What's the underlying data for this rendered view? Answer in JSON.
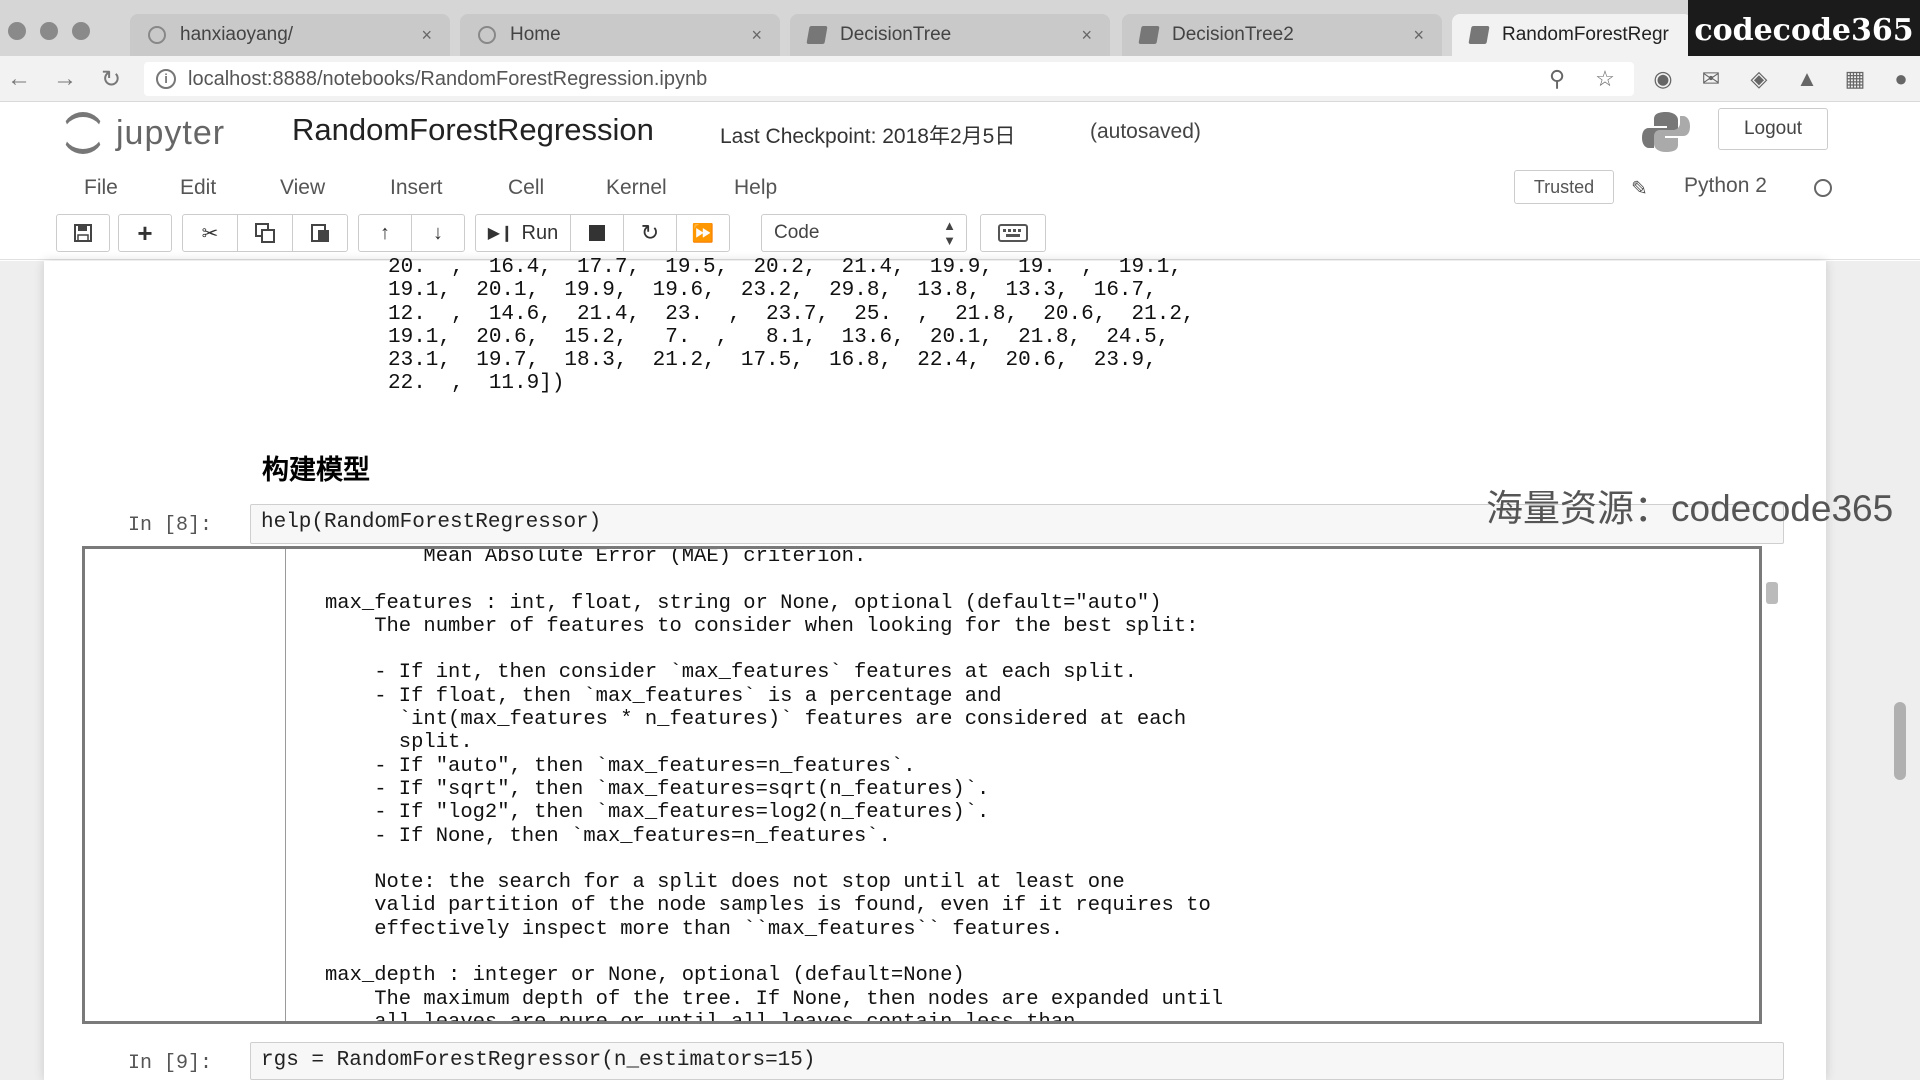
{
  "browser": {
    "tabs": [
      {
        "title": "hanxiaoyang/",
        "close": "×"
      },
      {
        "title": "Home",
        "close": "×"
      },
      {
        "title": "DecisionTree",
        "close": "×"
      },
      {
        "title": "DecisionTree2",
        "close": "×"
      },
      {
        "title": "RandomForestRegr",
        "close": ""
      }
    ],
    "watermark_badge": "codecode365",
    "url": "localhost:8888/notebooks/RandomForestRegression.ipynb",
    "info_glyph": "i"
  },
  "jupyter": {
    "logo_text": "jupyter",
    "notebook_name": "RandomForestRegression",
    "checkpoint": "Last Checkpoint: 2018年2月5日",
    "autosave": "(autosaved)",
    "logout": "Logout",
    "menu": [
      "File",
      "Edit",
      "View",
      "Insert",
      "Cell",
      "Kernel",
      "Help"
    ],
    "trusted": "Trusted",
    "kernel": "Python 2",
    "toolbar": {
      "run_label": "Run",
      "cell_type": "Code"
    }
  },
  "notebook": {
    "array_output": "20.  ,  16.4,  17.7,  19.5,  20.2,  21.4,  19.9,  19.  ,  19.1,\n19.1,  20.1,  19.9,  19.6,  23.2,  29.8,  13.8,  13.3,  16.7,\n12.  ,  14.6,  21.4,  23.  ,  23.7,  25.  ,  21.8,  20.6,  21.2,\n19.1,  20.6,  15.2,   7.  ,   8.1,  13.6,  20.1,  21.8,  24.5,\n23.1,  19.7,  18.3,  21.2,  17.5,  16.8,  22.4,  20.6,  23.9,\n22.  ,  11.9])",
    "heading": "构建模型",
    "cell8": {
      "prompt": "In [8]:",
      "source": "help(RandomForestRegressor)"
    },
    "help_output": "        Mean Absolute Error (MAE) criterion.\n\nmax_features : int, float, string or None, optional (default=\"auto\")\n    The number of features to consider when looking for the best split:\n\n    - If int, then consider `max_features` features at each split.\n    - If float, then `max_features` is a percentage and\n      `int(max_features * n_features)` features are considered at each\n      split.\n    - If \"auto\", then `max_features=n_features`.\n    - If \"sqrt\", then `max_features=sqrt(n_features)`.\n    - If \"log2\", then `max_features=log2(n_features)`.\n    - If None, then `max_features=n_features`.\n\n    Note: the search for a split does not stop until at least one\n    valid partition of the node samples is found, even if it requires to\n    effectively inspect more than ``max_features`` features.\n\nmax_depth : integer or None, optional (default=None)\n    The maximum depth of the tree. If None, then nodes are expanded until\n    all leaves are pure or until all leaves contain less than",
    "cell9": {
      "prompt": "In [9]:",
      "source": "rgs = RandomForestRegressor(n_estimators=15)"
    },
    "overlay_watermark": "海量资源：codecode365"
  },
  "colors": {
    "tabbar": "#d6d6d6",
    "watermark_box": "#1b1b1b",
    "notebook_bg": "#eeeeee"
  }
}
